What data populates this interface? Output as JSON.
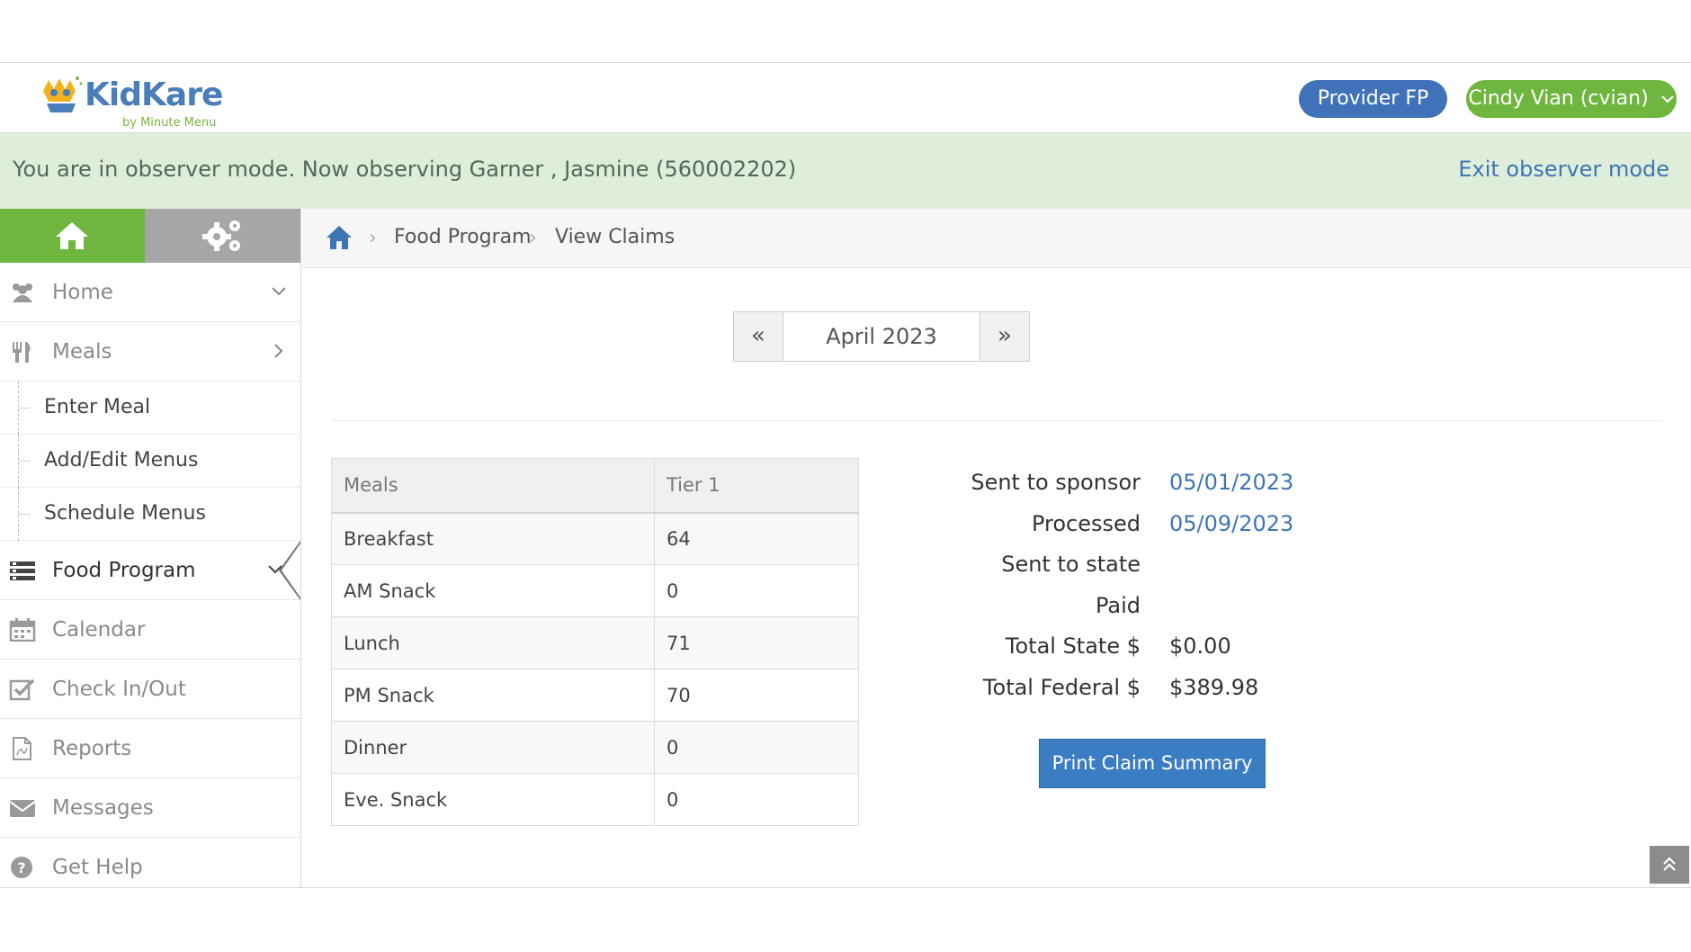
{
  "header": {
    "logo_text": "KidKare",
    "logo_sub": "by Minute Menu",
    "provider_button": "Provider FP",
    "user_button": "Cindy Vian (cvian)"
  },
  "observer": {
    "message": "You are in observer mode. Now observing Garner , Jasmine (560002202)",
    "exit_link": "Exit observer mode"
  },
  "sidebar": {
    "items": [
      {
        "label": "Home",
        "icon": "users-icon"
      },
      {
        "label": "Meals",
        "icon": "utensils-icon"
      },
      {
        "label": "Food Program",
        "icon": "list-icon"
      },
      {
        "label": "Calendar",
        "icon": "calendar-icon"
      },
      {
        "label": "Check In/Out",
        "icon": "checkbox-icon"
      },
      {
        "label": "Reports",
        "icon": "document-icon"
      },
      {
        "label": "Messages",
        "icon": "envelope-icon"
      },
      {
        "label": "Get Help",
        "icon": "question-icon"
      }
    ],
    "meals_sub": [
      "Enter Meal",
      "Add/Edit Menus",
      "Schedule Menus"
    ]
  },
  "breadcrumb": {
    "items": [
      "Food Program",
      "View Claims"
    ]
  },
  "month_nav": {
    "prev": "«",
    "label": "April 2023",
    "next": "»"
  },
  "meals_table": {
    "headers": [
      "Meals",
      "Tier 1"
    ],
    "rows": [
      [
        "Breakfast",
        "64"
      ],
      [
        "AM Snack",
        "0"
      ],
      [
        "Lunch",
        "71"
      ],
      [
        "PM Snack",
        "70"
      ],
      [
        "Dinner",
        "0"
      ],
      [
        "Eve. Snack",
        "0"
      ]
    ]
  },
  "summary": {
    "sent_to_sponsor_label": "Sent to sponsor",
    "sent_to_sponsor_value": "05/01/2023",
    "processed_label": "Processed",
    "processed_value": "05/09/2023",
    "sent_to_state_label": "Sent to state",
    "sent_to_state_value": "",
    "paid_label": "Paid",
    "paid_value": "",
    "total_state_label": "Total State $",
    "total_state_value": "$0.00",
    "total_federal_label": "Total Federal $",
    "total_federal_value": "$389.98"
  },
  "print_button": "Print Claim Summary",
  "colors": {
    "brand_green": "#6fb63f",
    "brand_blue": "#3f72b9",
    "observer_bg": "#deeedb"
  }
}
